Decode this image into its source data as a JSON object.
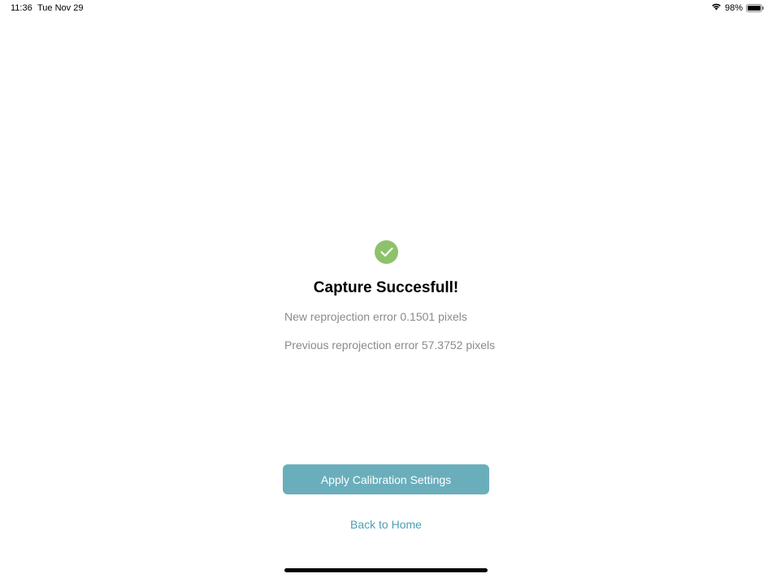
{
  "status_bar": {
    "time": "11:36",
    "date": "Tue Nov 29",
    "battery_percent": "98%",
    "battery_level": 0.98,
    "icons": [
      "wifi-icon",
      "battery-icon"
    ]
  },
  "result": {
    "icon": "checkmark-icon",
    "icon_color": "#8dc26a",
    "title": "Capture Succesfull!",
    "new_error": "New reprojection error 0.1501 pixels",
    "previous_error": "Previous reprojection error 57.3752 pixels"
  },
  "actions": {
    "apply_label": "Apply Calibration Settings",
    "apply_color": "#6aaebc",
    "back_label": "Back to Home",
    "back_color": "#4a9fb3"
  }
}
